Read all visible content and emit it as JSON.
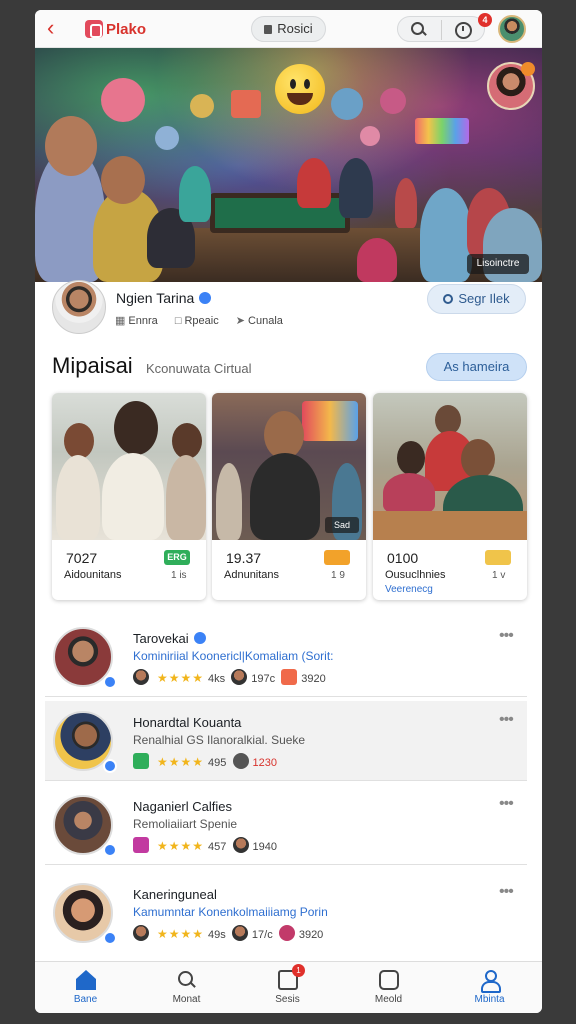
{
  "topbar": {
    "app_name": "Plako",
    "pill_label": "Rosici",
    "notification_count": "4"
  },
  "hero": {
    "badge": "Lisoinctre"
  },
  "profile": {
    "name": "Ngien Tarina",
    "meta": [
      "Ennra",
      "Rpeaic",
      "Cunala"
    ],
    "search_button": "Segr Ilek"
  },
  "section": {
    "title": "Mipaisai",
    "subtitle": "Kconuwata Cirtual",
    "button": "As hameira"
  },
  "cards": [
    {
      "number": "7027",
      "label": "Aidounitans",
      "label2": "",
      "tag": "ERG",
      "tag_color": "#2fae5a",
      "count": "1 is",
      "photo_badge": ""
    },
    {
      "number": "19.37",
      "label": "Adnunitans",
      "label2": "",
      "tag": "",
      "tag_color": "#f2a22a",
      "count": "1 9",
      "photo_badge": "Sad"
    },
    {
      "number": "0100",
      "label": "Ousuclhnies",
      "label2": "Veerenecg",
      "tag": "",
      "tag_color": "#f0c44a",
      "count": "1 v",
      "photo_badge": ""
    }
  ],
  "list": [
    {
      "title": "Tarovekai",
      "subtitle": "Kominiriial Koonericl|Komaliam (Sorit:",
      "subtitle_style": "blue",
      "rating": "4ks",
      "meta2": "197c",
      "meta3": "3920",
      "verified": true
    },
    {
      "title": "Honardtal Kouanta",
      "subtitle": "Renalhial GS Ilanoralkial. Sueke",
      "subtitle_style": "gray",
      "rating": "495",
      "meta2": "",
      "meta3": "1230",
      "verified": false
    },
    {
      "title": "Naganierl Calfies",
      "subtitle": "Remoliaiiart Spenie",
      "subtitle_style": "gray",
      "rating": "457",
      "meta2": "",
      "meta3": "1940",
      "verified": false
    },
    {
      "title": "Kaneringuneal",
      "subtitle": "Kamumntar Konenkolmaiiiamg Porin",
      "subtitle_style": "blue",
      "rating": "49s",
      "meta2": "17/c",
      "meta3": "3920",
      "verified": false
    }
  ],
  "nav": [
    {
      "label": "Bane",
      "active": true
    },
    {
      "label": "Monat",
      "active": false
    },
    {
      "label": "Sesis",
      "active": false,
      "badge": "1"
    },
    {
      "label": "Meold",
      "active": false
    },
    {
      "label": "Mbinta",
      "active": true
    }
  ],
  "colors": {
    "accent": "#1f68c9",
    "brand": "#d8332d",
    "star": "#f1b51c"
  }
}
